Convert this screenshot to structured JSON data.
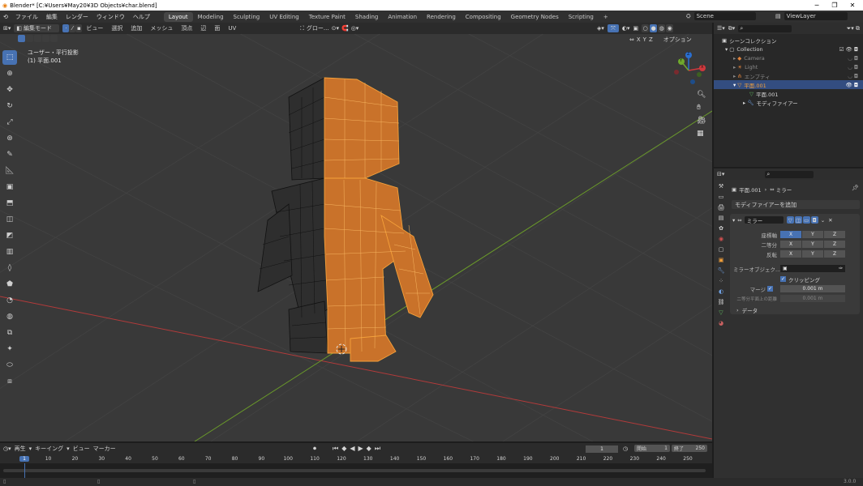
{
  "window": {
    "title": "Blender* [C:¥Users¥May20¥3D Objects¥char.blend]",
    "min": "─",
    "max": "❐",
    "close": "✕"
  },
  "menu": {
    "items": [
      "ファイル",
      "編集",
      "レンダー",
      "ウィンドウ",
      "ヘルプ"
    ]
  },
  "workspaces": {
    "tabs": [
      "Layout",
      "Modeling",
      "Sculpting",
      "UV Editing",
      "Texture Paint",
      "Shading",
      "Animation",
      "Rendering",
      "Compositing",
      "Geometry Nodes",
      "Scripting"
    ],
    "active": "Layout",
    "add": "+"
  },
  "scene": {
    "label": "Scene",
    "view_layer": "ViewLayer"
  },
  "viewport_header": {
    "mode": "編集モード",
    "menus": [
      "ビュー",
      "選択",
      "追加",
      "メッシュ",
      "頂点",
      "辺",
      "面",
      "UV"
    ],
    "transform": "グロー...",
    "options": "オプション",
    "axes": [
      "X",
      "Y",
      "Z"
    ]
  },
  "viewport": {
    "view_name": "ユーザー・平行投影",
    "object_name": "(1) 平面.001",
    "gizmo": {
      "x": "X",
      "y": "Y",
      "z": "Z"
    }
  },
  "outliner": {
    "header": "シーンコレクション",
    "items": [
      {
        "label": "Collection"
      },
      {
        "label": "Camera"
      },
      {
        "label": "Light"
      },
      {
        "label": "エンプティ"
      },
      {
        "label": "平面.001"
      },
      {
        "label": "平面.001"
      },
      {
        "label": "モディファイアー"
      }
    ]
  },
  "properties": {
    "breadcrumb_obj": "平面.001",
    "breadcrumb_mod": "ミラー",
    "add_modifier": "モディファイアーを追加",
    "modifier_name": "ミラー",
    "rows": [
      {
        "label": "座標軸",
        "x": "X",
        "y": "Y",
        "z": "Z"
      },
      {
        "label": "二等分",
        "x": "X",
        "y": "Y",
        "z": "Z"
      },
      {
        "label": "反転",
        "x": "X",
        "y": "Y",
        "z": "Z"
      }
    ],
    "mirror_object": "ミラーオブジェク...",
    "clipping": "クリッピング",
    "merge_label": "マージ",
    "merge_value": "0.001 m",
    "bisect_label": "二等分平面上の距離",
    "bisect_value": "0.001 m",
    "data_label": "データ"
  },
  "timeline": {
    "menus": [
      "再生",
      "キーイング",
      "ビュー",
      "マーカー"
    ],
    "current_frame": "1",
    "start_label": "開始",
    "start": "1",
    "end_label": "終了",
    "end": "250",
    "ticks": [
      "1",
      "10",
      "20",
      "30",
      "40",
      "50",
      "60",
      "70",
      "80",
      "90",
      "100",
      "110",
      "120",
      "130",
      "140",
      "150",
      "160",
      "170",
      "180",
      "190",
      "200",
      "210",
      "220",
      "230",
      "240",
      "250"
    ]
  },
  "status": {
    "version": "3.0.0"
  },
  "colors": {
    "accent": "#4772b3",
    "selection": "#f5a13a",
    "x_axis": "#b23a3a",
    "y_axis": "#6a9a2a"
  }
}
